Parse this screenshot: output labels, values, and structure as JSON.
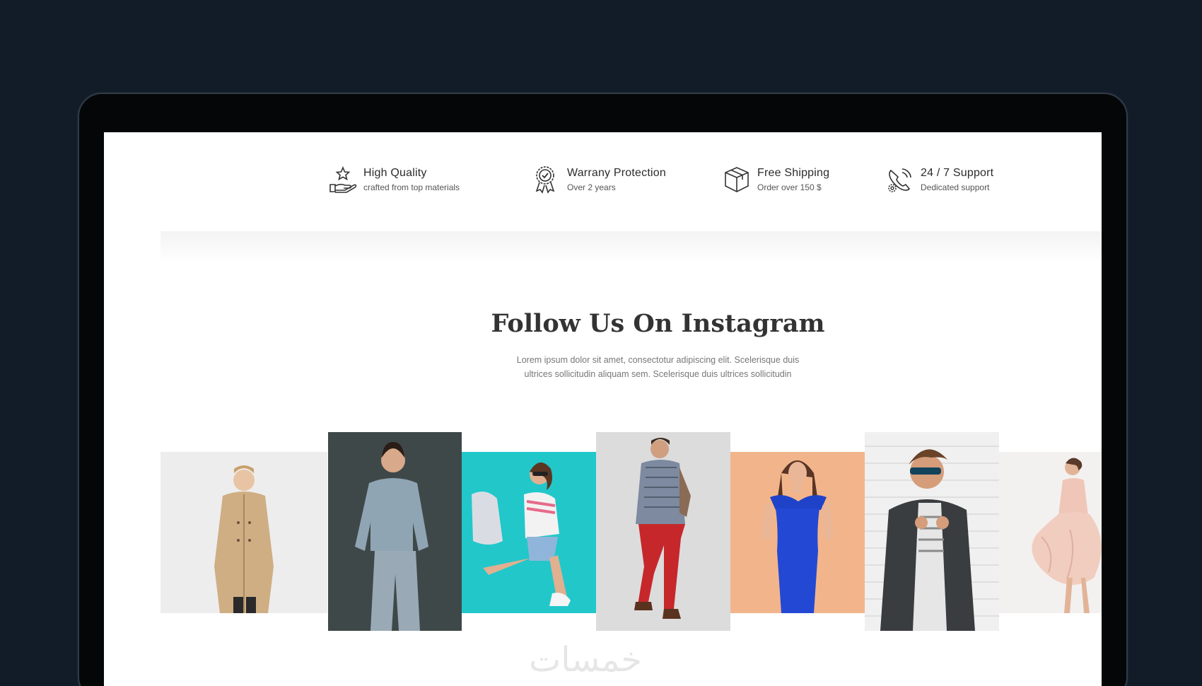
{
  "features": [
    {
      "icon": "hand-star-icon",
      "title": "High Quality",
      "subtitle": "crafted from top materials"
    },
    {
      "icon": "award-badge-icon",
      "title": "Warrany Protection",
      "subtitle": "Over 2 years"
    },
    {
      "icon": "box-package-icon",
      "title": "Free Shipping",
      "subtitle": "Order over 150 $"
    },
    {
      "icon": "headset-support-icon",
      "title": "24 / 7 Support",
      "subtitle": "Dedicated support"
    }
  ],
  "instagram": {
    "title": "Follow Us On Instagram",
    "description_line1": "Lorem ipsum dolor sit amet, consectotur adipiscing elit. Scelerisque duis",
    "description_line2": "ultrices sollicitudin aliquam sem. Scelerisque duis ultrices sollicitudin"
  },
  "gallery": [
    {
      "subject": "man-in-beige-trench-coat",
      "bg": "#eeeeee"
    },
    {
      "subject": "woman-in-grey-knit",
      "bg": "#3c4546"
    },
    {
      "subject": "woman-jumping-on-cyan",
      "bg": "#25c8cb"
    },
    {
      "subject": "man-in-red-trousers",
      "bg": "#dcdcdc"
    },
    {
      "subject": "woman-in-blue-dress",
      "bg": "#f1b68d"
    },
    {
      "subject": "man-with-sunglasses-brick-wall",
      "bg": "#efefef"
    },
    {
      "subject": "woman-in-pink-dress",
      "bg": "#f2f2f2"
    }
  ],
  "watermark": "خمسات"
}
